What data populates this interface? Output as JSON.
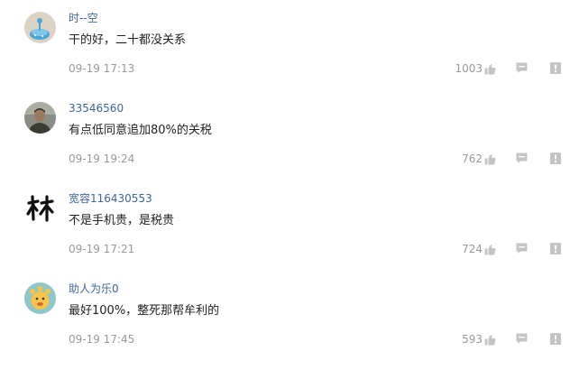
{
  "comments": [
    {
      "username": "时--空",
      "content": "干的好，二十都没关系",
      "time": "09-19 17:13",
      "likes": "1003",
      "avatar_icon": "blue-cartoon-avatar-icon"
    },
    {
      "username": "33546560",
      "content": "有点低同意追加80%的关税",
      "time": "09-19 19:24",
      "likes": "762",
      "avatar_icon": "man-photo-avatar-icon"
    },
    {
      "username": "宽容116430553",
      "content": "不是手机贵，是税贵",
      "time": "09-19 17:21",
      "likes": "724",
      "avatar_icon": "calligraphy-avatar-icon"
    },
    {
      "username": "助人为乐0",
      "content": "最好100%，整死那帮牟利的",
      "time": "09-19 17:45",
      "likes": "593",
      "avatar_icon": "cartoon-sun-avatar-icon"
    }
  ],
  "colors": {
    "username": "#406599",
    "content": "#222222",
    "meta": "#999999",
    "icon": "#c4c4c4"
  },
  "icons": {
    "like": "thumbs-up-icon",
    "reply": "reply-comment-icon",
    "report": "report-icon"
  }
}
